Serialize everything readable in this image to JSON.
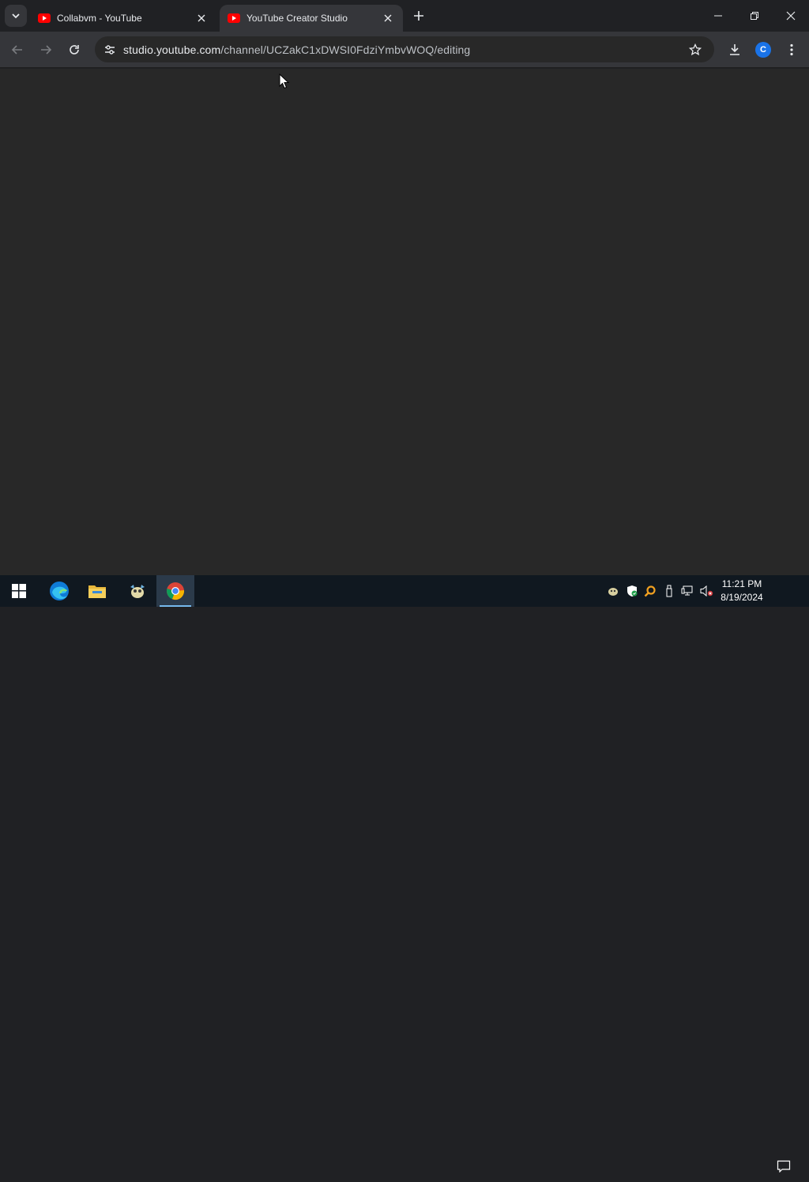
{
  "browser": {
    "tabs": [
      {
        "title": "Collabvm - YouTube",
        "active": false
      },
      {
        "title": "YouTube Creator Studio",
        "active": true
      }
    ],
    "address": {
      "host": "studio.youtube.com",
      "path": "/channel/UCZakC1xDWSI0FdziYmbvWOQ/editing"
    },
    "profile_initial": "C",
    "colors": {
      "tab_active": "#35363a",
      "content_bg": "#282828",
      "accent": "#1a73e8",
      "youtube_red": "#ff0000"
    }
  },
  "icons": {
    "tab_search": "chevron-down-icon",
    "back": "back-arrow-icon",
    "forward": "forward-arrow-icon",
    "reload": "reload-icon",
    "site_info": "tune-icon",
    "bookmark": "star-icon",
    "download": "download-icon",
    "menu": "kebab-menu-icon"
  },
  "taskbar": {
    "apps": [
      "start",
      "edge",
      "file-explorer",
      "app-mascot",
      "chrome"
    ],
    "time": "11:21 PM",
    "date": "8/19/2024"
  }
}
